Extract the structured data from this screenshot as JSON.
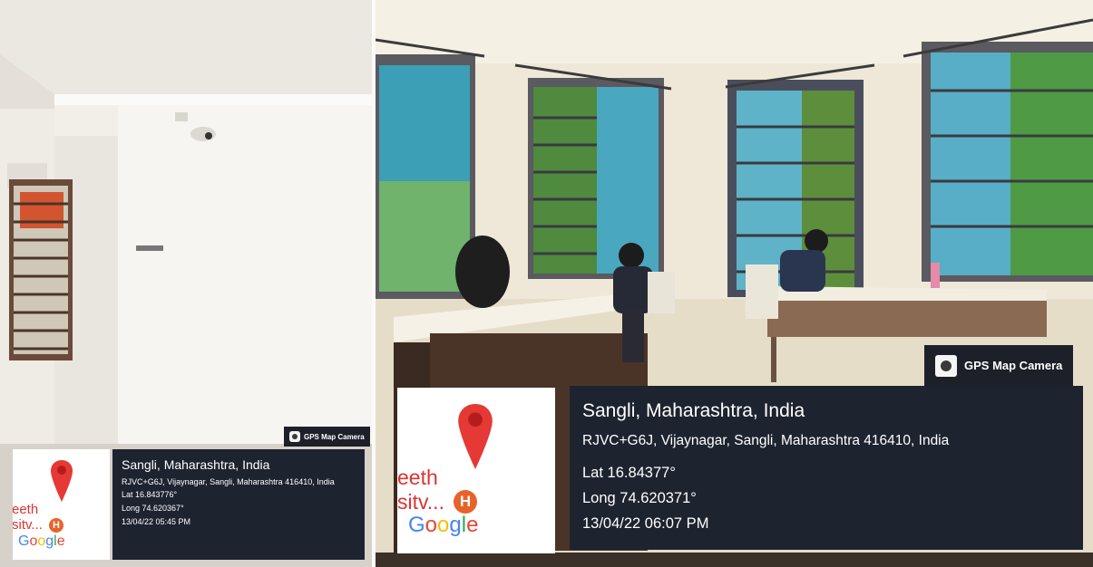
{
  "left_photo": {
    "badge": {
      "icon": "camera-icon",
      "label": "GPS Map Camera"
    },
    "map_card": {
      "place_text_1": "eeth",
      "place_text_2": "sitv...",
      "marker_letter": "H",
      "google_logo": {
        "G1": "G",
        "o1": "o",
        "o2": "o",
        "g": "g",
        "l": "l",
        "e": "e"
      }
    },
    "info": {
      "location": "Sangli, Maharashtra, India",
      "address": "RJVC+G6J, Vijaynagar, Sangli, Maharashtra 416410, India",
      "lat": "Lat 16.843776°",
      "long": "Long 74.620367°",
      "timestamp": "13/04/22 05:45 PM"
    }
  },
  "right_photo": {
    "badge": {
      "icon": "camera-icon",
      "label": "GPS Map Camera"
    },
    "map_card": {
      "place_text_1": "eeth",
      "place_text_2": "sitv...",
      "marker_letter": "H",
      "google_logo": {
        "G1": "G",
        "o1": "o",
        "o2": "o",
        "g": "g",
        "l": "l",
        "e": "e"
      }
    },
    "info": {
      "location": "Sangli, Maharashtra, India",
      "address": "RJVC+G6J, Vijaynagar, Sangli, Maharashtra 416410, India",
      "lat": "Lat 16.84377°",
      "long": "Long 74.620371°",
      "timestamp": "13/04/22 06:07 PM"
    }
  },
  "colors": {
    "overlay_panel": "#1e2330",
    "pin": "#e53935",
    "hospital_marker": "#e8622c"
  }
}
